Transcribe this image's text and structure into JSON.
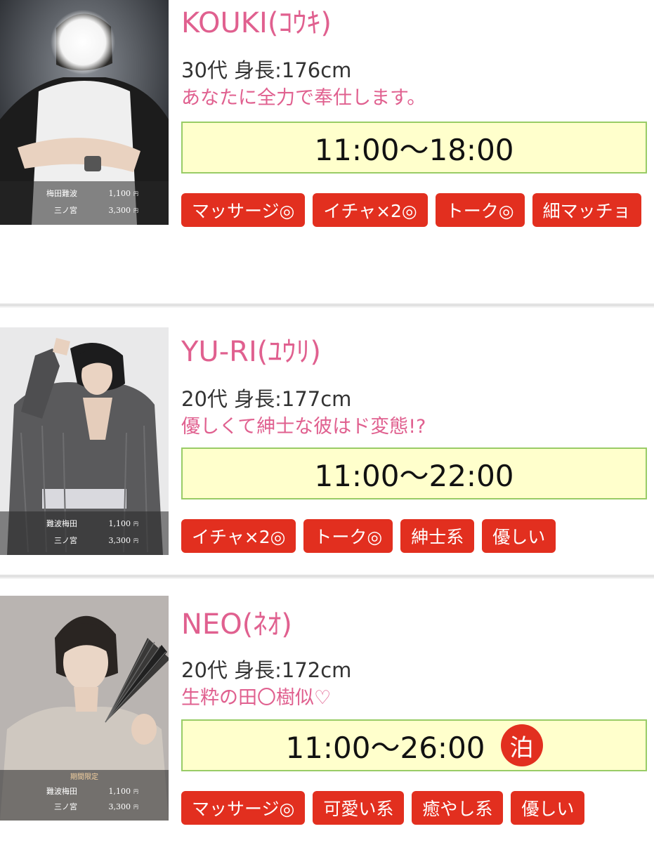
{
  "casts": [
    {
      "name": "KOUKI(ｺｳｷ)",
      "spec": "30代 身長:176cm",
      "catch": "あなたに全力で奉仕します。",
      "time": "11:00〜18:00",
      "stay": "",
      "tags": [
        "マッサージ◎",
        "イチャ×2◎",
        "トーク◎",
        "細マッチョ"
      ],
      "period": "",
      "prices": [
        {
          "area": "梅田難波",
          "price": "1,100",
          "unit": "円"
        },
        {
          "area": "三ノ宮",
          "price": "3,300",
          "unit": "円"
        }
      ]
    },
    {
      "name": "YU-RI(ﾕｳﾘ)",
      "spec": "20代 身長:177cm",
      "catch": "優しくて紳士な彼はド変態!?",
      "time": "11:00〜22:00",
      "stay": "",
      "tags": [
        "イチャ×2◎",
        "トーク◎",
        "紳士系",
        "優しい"
      ],
      "period": "",
      "prices": [
        {
          "area": "難波梅田",
          "price": "1,100",
          "unit": "円"
        },
        {
          "area": "三ノ宮",
          "price": "3,300",
          "unit": "円"
        }
      ]
    },
    {
      "name": "NEO(ﾈｵ)",
      "spec": "20代 身長:172cm",
      "catch": "生粋の田〇樹似♡",
      "time": "11:00〜26:00",
      "stay": "泊",
      "tags": [
        "マッサージ◎",
        "可愛い系",
        "癒やし系",
        "優しい"
      ],
      "period": "期間限定",
      "prices": [
        {
          "area": "難波梅田",
          "price": "1,100",
          "unit": "円"
        },
        {
          "area": "三ノ宮",
          "price": "3,300",
          "unit": "円"
        }
      ]
    }
  ],
  "colors": {
    "name": "#e0608f",
    "tag_bg": "#e22f1f",
    "time_bg": "#ffffcc",
    "time_border": "#99cc66"
  }
}
